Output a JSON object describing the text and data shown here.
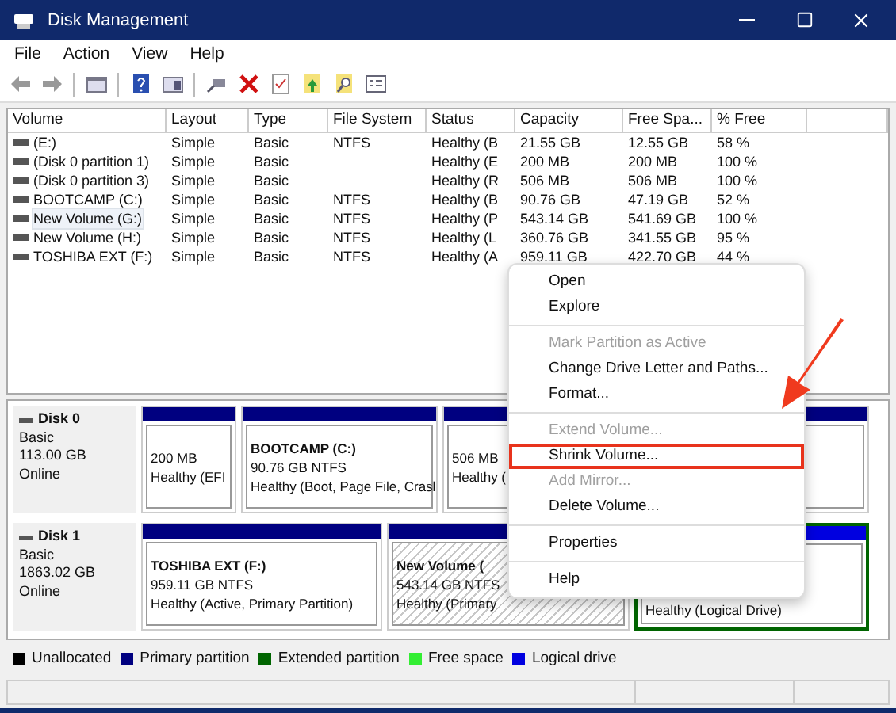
{
  "window": {
    "title": "Disk Management"
  },
  "menu_bar": [
    "File",
    "Action",
    "View",
    "Help"
  ],
  "table": {
    "columns": [
      "Volume",
      "Layout",
      "Type",
      "File System",
      "Status",
      "Capacity",
      "Free Spa...",
      "% Free"
    ],
    "rows": [
      {
        "selected": false,
        "cells": [
          "(E:)",
          "Simple",
          "Basic",
          "NTFS",
          "Healthy (B",
          "21.55 GB",
          "12.55 GB",
          "58 %"
        ]
      },
      {
        "selected": false,
        "cells": [
          "(Disk 0 partition 1)",
          "Simple",
          "Basic",
          "",
          "Healthy (E",
          "200 MB",
          "200 MB",
          "100 %"
        ]
      },
      {
        "selected": false,
        "cells": [
          "(Disk 0 partition 3)",
          "Simple",
          "Basic",
          "",
          "Healthy (R",
          "506 MB",
          "506 MB",
          "100 %"
        ]
      },
      {
        "selected": false,
        "cells": [
          "BOOTCAMP (C:)",
          "Simple",
          "Basic",
          "NTFS",
          "Healthy (B",
          "90.76 GB",
          "47.19 GB",
          "52 %"
        ]
      },
      {
        "selected": true,
        "cells": [
          "New Volume (G:)",
          "Simple",
          "Basic",
          "NTFS",
          "Healthy (P",
          "543.14 GB",
          "541.69 GB",
          "100 %"
        ]
      },
      {
        "selected": false,
        "cells": [
          "New Volume (H:)",
          "Simple",
          "Basic",
          "NTFS",
          "Healthy (L",
          "360.76 GB",
          "341.55 GB",
          "95 %"
        ]
      },
      {
        "selected": false,
        "cells": [
          "TOSHIBA EXT (F:)",
          "Simple",
          "Basic",
          "NTFS",
          "Healthy (A",
          "959.11 GB",
          "422.70 GB",
          "44 %"
        ]
      }
    ]
  },
  "disks": [
    {
      "name": "Disk 0",
      "type": "Basic",
      "size": "113.00 GB",
      "status": "Online",
      "partitions": [
        {
          "kind": "primary",
          "selected": false,
          "lines": [
            "200 MB",
            "Healthy (EFI"
          ]
        },
        {
          "kind": "primary",
          "selected": false,
          "title": "BOOTCAMP  (C:)",
          "lines": [
            "90.76 GB NTFS",
            "Healthy (Boot, Page File, Crasl"
          ]
        },
        {
          "kind": "primary",
          "selected": false,
          "lines": [
            "506 MB",
            "Healthy ("
          ]
        }
      ]
    },
    {
      "name": "Disk 1",
      "type": "Basic",
      "size": "1863.02 GB",
      "status": "Online",
      "partitions": [
        {
          "kind": "primary",
          "selected": false,
          "title": "TOSHIBA EXT  (F:)",
          "lines": [
            "959.11 GB NTFS",
            "Healthy (Active, Primary Partition)"
          ]
        },
        {
          "kind": "primary",
          "selected": true,
          "title": "New Volume  (",
          "lines": [
            "543.14 GB NTFS",
            "Healthy (Primary"
          ]
        },
        {
          "kind": "logical",
          "selected": false,
          "lines": [
            "Healthy (Logical Drive)"
          ]
        }
      ]
    }
  ],
  "legend": [
    {
      "label": "Unallocated",
      "color": "#000000"
    },
    {
      "label": "Primary partition",
      "color": "#000080"
    },
    {
      "label": "Extended partition",
      "color": "#006400"
    },
    {
      "label": "Free space",
      "color": "#33ee33"
    },
    {
      "label": "Logical drive",
      "color": "#0000e0"
    }
  ],
  "context_menu": [
    {
      "kind": "item",
      "label": "Open",
      "disabled": false,
      "highlighted": false
    },
    {
      "kind": "item",
      "label": "Explore",
      "disabled": false,
      "highlighted": false
    },
    {
      "kind": "separator"
    },
    {
      "kind": "item",
      "label": "Mark Partition as Active",
      "disabled": true,
      "highlighted": false
    },
    {
      "kind": "item",
      "label": "Change Drive Letter and Paths...",
      "disabled": false,
      "highlighted": false
    },
    {
      "kind": "item",
      "label": "Format...",
      "disabled": false,
      "highlighted": false
    },
    {
      "kind": "separator"
    },
    {
      "kind": "item",
      "label": "Extend Volume...",
      "disabled": true,
      "highlighted": false
    },
    {
      "kind": "item",
      "label": "Shrink Volume...",
      "disabled": false,
      "highlighted": true
    },
    {
      "kind": "item",
      "label": "Add Mirror...",
      "disabled": true,
      "highlighted": false
    },
    {
      "kind": "item",
      "label": "Delete Volume...",
      "disabled": false,
      "highlighted": false
    },
    {
      "kind": "separator"
    },
    {
      "kind": "item",
      "label": "Properties",
      "disabled": false,
      "highlighted": false
    },
    {
      "kind": "separator"
    },
    {
      "kind": "item",
      "label": "Help",
      "disabled": false,
      "highlighted": false
    }
  ]
}
